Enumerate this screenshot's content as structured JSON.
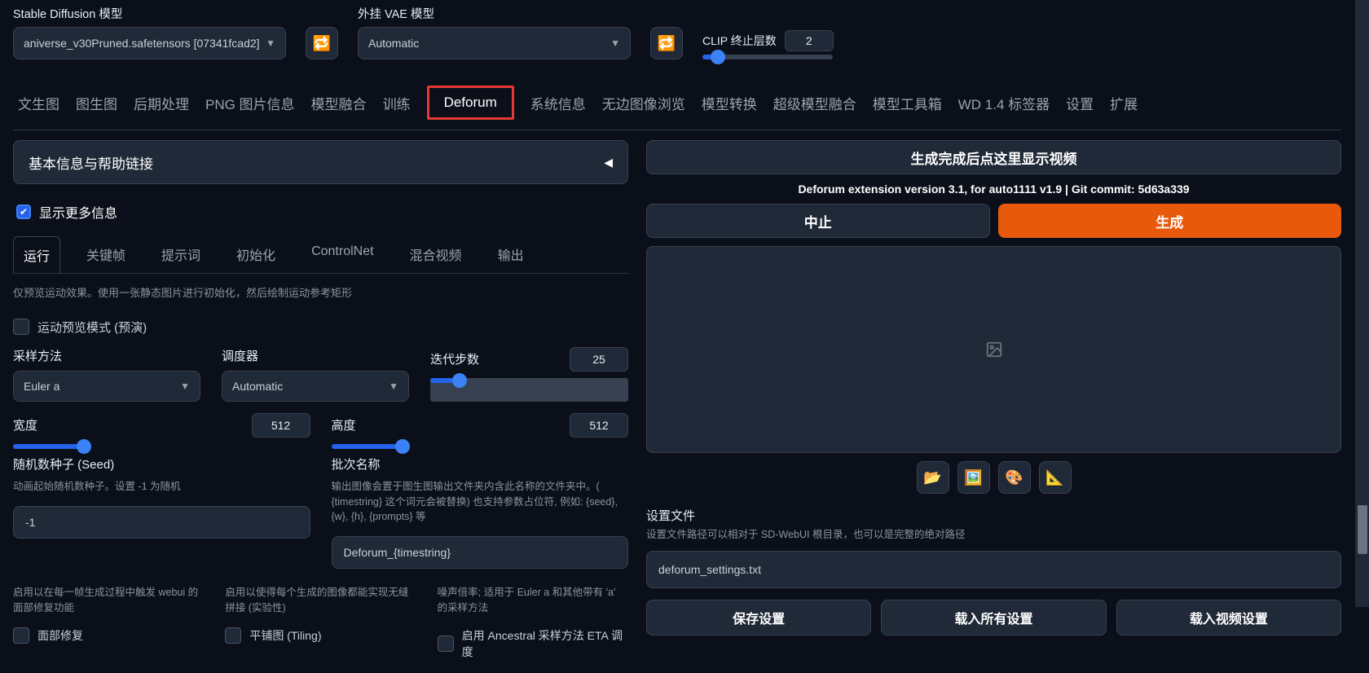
{
  "top": {
    "sd_label": "Stable Diffusion 模型",
    "sd_value": "aniverse_v30Pruned.safetensors [07341fcad2]",
    "vae_label": "外挂 VAE 模型",
    "vae_value": "Automatic",
    "clip_label": "CLIP 终止层数",
    "clip_value": "2"
  },
  "tabs": [
    "文生图",
    "图生图",
    "后期处理",
    "PNG 图片信息",
    "模型融合",
    "训练",
    "Deforum",
    "系统信息",
    "无边图像浏览",
    "模型转换",
    "超级模型融合",
    "模型工具箱",
    "WD 1.4 标签器",
    "设置",
    "扩展"
  ],
  "active_tab_index": 6,
  "accordion_header": "基本信息与帮助链接",
  "show_more_label": "显示更多信息",
  "inner_tabs": [
    "运行",
    "关键帧",
    "提示词",
    "初始化",
    "ControlNet",
    "混合视频",
    "输出"
  ],
  "inner_active_index": 0,
  "preview_hint": "仅预览运动效果。使用一张静态图片进行初始化，然后绘制运动参考矩形",
  "motion_preview_label": "运动预览模式 (预演)",
  "sampler": {
    "label": "采样方法",
    "value": "Euler a"
  },
  "scheduler": {
    "label": "调度器",
    "value": "Automatic"
  },
  "steps": {
    "label": "迭代步数",
    "value": "25",
    "fill_pct": 15
  },
  "width": {
    "label": "宽度",
    "value": "512",
    "fill_pct": 24
  },
  "height": {
    "label": "高度",
    "value": "512",
    "fill_pct": 24
  },
  "seed": {
    "label": "随机数种子 (Seed)",
    "hint": "动画起始随机数种子。设置 -1 为随机",
    "value": "-1"
  },
  "batch_name": {
    "label": "批次名称",
    "hint": "输出图像会置于图生图输出文件夹内含此名称的文件夹中。( {timestring} 这个词元会被替换) 也支持参数占位符, 例如: {seed}, {w}, {h}, {prompts} 等",
    "value": "Deforum_{timestring}"
  },
  "opts": {
    "face_restore_hint": "启用以在每一帧生成过程中触发 webui 的面部修复功能",
    "face_restore_label": "面部修复",
    "tiling_hint": "启用以使得每个生成的图像都能实现无缝拼接 (实验性)",
    "tiling_label": "平铺图 (Tiling)",
    "eta_hint": "噪声倍率; 适用于 Euler a 和其他带有 'a' 的采样方法",
    "eta_label": "启用 Ancestral 采样方法 ETA 调度"
  },
  "right": {
    "video_btn": "生成完成后点这里显示视频",
    "version": "Deforum extension version 3.1, for auto1111 v1.9 | Git commit: 5d63a339",
    "abort": "中止",
    "generate": "生成",
    "settings_file_label": "设置文件",
    "settings_file_hint": "设置文件路径可以相对于 SD-WebUI 根目录，也可以是完整的绝对路径",
    "settings_file_value": "deforum_settings.txt",
    "save": "保存设置",
    "load_all": "载入所有设置",
    "load_video": "载入视频设置",
    "icons": [
      "📂",
      "🖼️",
      "🎨",
      "📐"
    ]
  }
}
